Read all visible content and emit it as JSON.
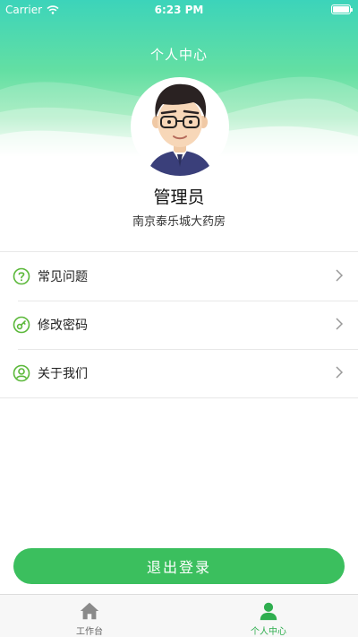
{
  "status_bar": {
    "carrier": "Carrier",
    "time": "6:23 PM"
  },
  "header": {
    "title": "个人中心"
  },
  "profile": {
    "name": "管理员",
    "organization": "南京泰乐城大药房",
    "avatar": "cartoon-man-avatar"
  },
  "menu": [
    {
      "label": "常见问题",
      "icon": "question-circle-icon"
    },
    {
      "label": "修改密码",
      "icon": "key-circle-icon"
    },
    {
      "label": "关于我们",
      "icon": "user-circle-icon"
    }
  ],
  "logout": {
    "label": "退出登录"
  },
  "tabbar": {
    "tabs": [
      {
        "label": "工作台",
        "icon": "home-icon",
        "active": false
      },
      {
        "label": "个人中心",
        "icon": "person-icon",
        "active": true
      }
    ]
  },
  "colors": {
    "accent": "#3bbf5e",
    "header_top": "#3cd4ba",
    "active_tab": "#2fae4f",
    "icon_green": "#5bb83a"
  }
}
